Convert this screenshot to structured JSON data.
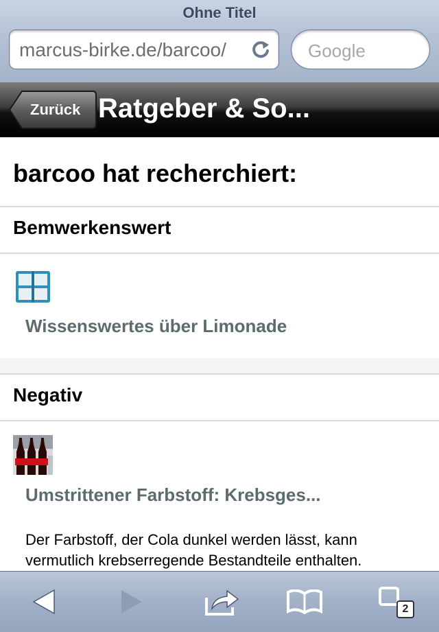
{
  "browser": {
    "page_title": "Ohne Titel",
    "url": "marcus-birke.de/barcoo/",
    "search_placeholder": "Google",
    "tab_count": "2"
  },
  "navbar": {
    "back_label": "Zurück",
    "title": "Ratgeber & So..."
  },
  "content": {
    "headline": "barcoo hat recherchiert:",
    "sections": [
      {
        "title": "Bemwerkenswert",
        "items": [
          {
            "icon": "book-icon",
            "link": "Wissenswertes über Limonade"
          }
        ]
      },
      {
        "title": "Negativ",
        "items": [
          {
            "icon": "cola-bottles-thumbnail",
            "link": "Umstrittener Farbstoff: Krebsges...",
            "text": "Der Farbstoff, der Cola dunkel werden lässt, kann vermutlich krebserregende Bestandteile enthalten."
          }
        ]
      }
    ]
  },
  "colors": {
    "navbar": "#000000",
    "chrome": "#a4b3c9",
    "link": "#5c6b6f",
    "divider": "#d2dadf"
  }
}
